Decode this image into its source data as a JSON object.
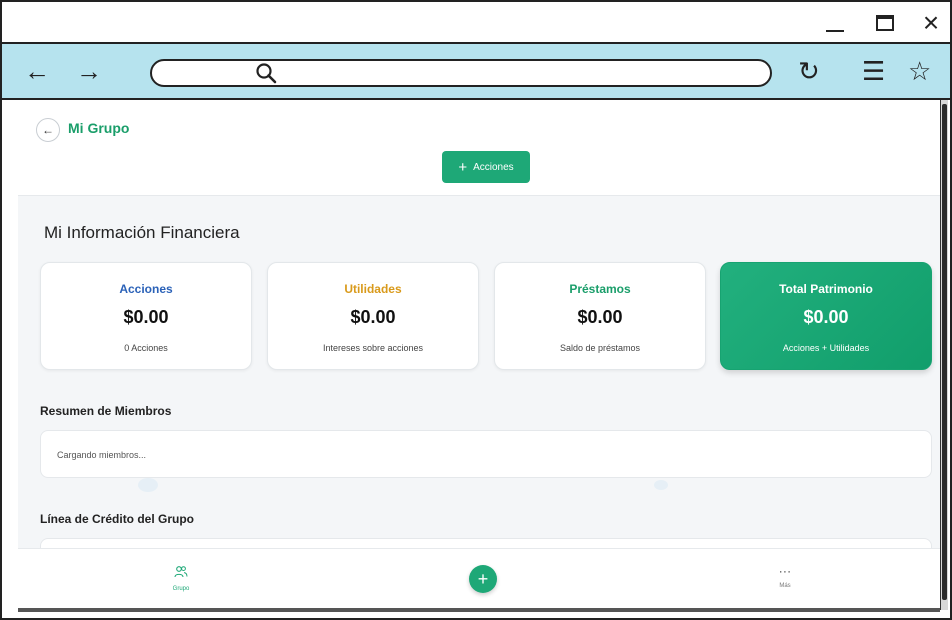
{
  "browser": {
    "window_controls": {
      "minimize": "_",
      "maximize": "",
      "close": "×"
    },
    "nav": {
      "back": "←",
      "forward": "→",
      "reload": "↻",
      "menu": "☰",
      "bookmark": "☆"
    },
    "url": ""
  },
  "header": {
    "title": "Mi Grupo",
    "back_icon": "←",
    "actions_button": {
      "plus": "+",
      "label": "Acciones"
    }
  },
  "main": {
    "section_title": "Mi Información Financiera",
    "cards": [
      {
        "label": "Acciones",
        "value": "$0.00",
        "sub": "0 Acciones",
        "color": "#2b62b8"
      },
      {
        "label": "Utilidades",
        "value": "$0.00",
        "sub": "Intereses sobre acciones",
        "color": "#d99a1b"
      },
      {
        "label": "Préstamos",
        "value": "$0.00",
        "sub": "Saldo de préstamos",
        "color": "#1a9e6a"
      },
      {
        "label": "Total Patrimonio",
        "value": "$0.00",
        "sub": "Acciones + Utilidades",
        "color": "#ffffff"
      }
    ],
    "members": {
      "title": "Resumen de Miembros",
      "loading": "Cargando miembros..."
    },
    "credit": {
      "title": "Línea de Crédito del Grupo"
    }
  },
  "bottom_nav": {
    "group": {
      "icon": "group-icon",
      "label": "Grupo"
    },
    "fab": {
      "label": "+"
    },
    "more": {
      "icon": "⋯",
      "label": "Más"
    }
  },
  "colors": {
    "accent": "#1ea877",
    "nav_bg": "#b6e3ee"
  }
}
